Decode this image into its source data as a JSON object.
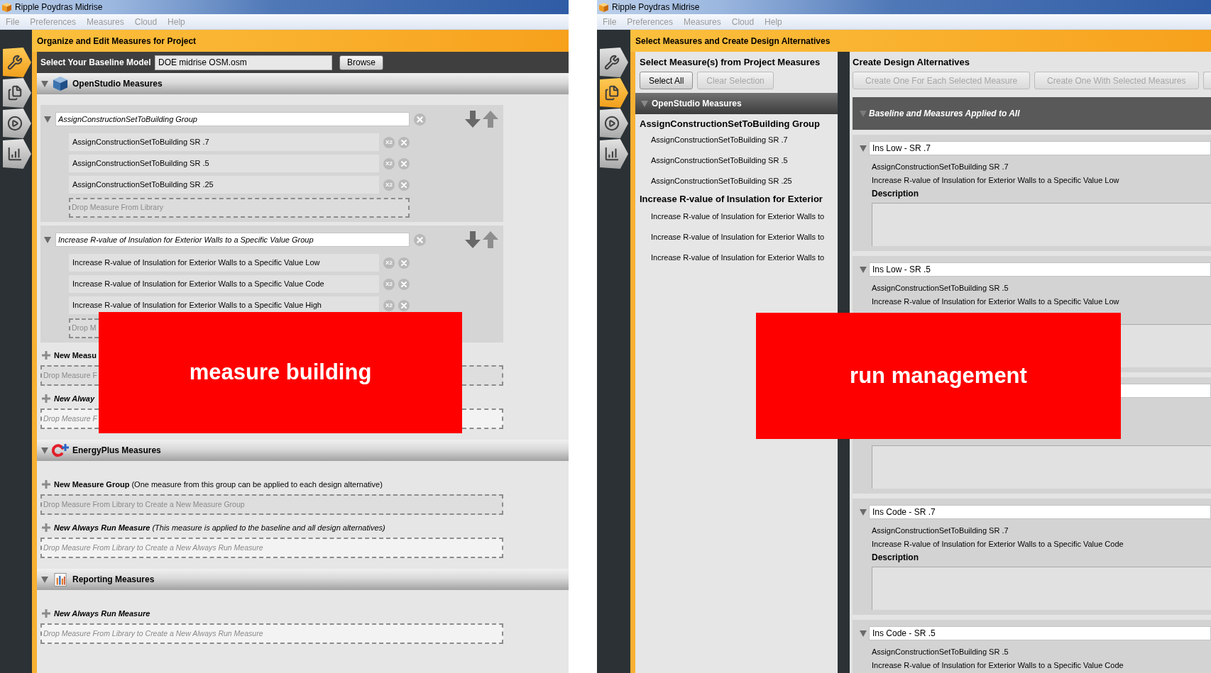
{
  "measure_window": {
    "title": "Ripple Poydras Midrise",
    "menu": [
      "File",
      "Preferences",
      "Measures",
      "Cloud",
      "Help"
    ],
    "side_tabs": [
      {
        "selected": true
      },
      {
        "selected": false
      },
      {
        "selected": false
      },
      {
        "selected": false
      }
    ],
    "header": "Organize and Edit Measures for Project",
    "baseline": {
      "label": "Select Your Baseline Model",
      "value": "DOE midrise OSM.osm",
      "button": "Browse"
    },
    "sections": [
      {
        "kind": "openstudio",
        "title": "OpenStudio Measures",
        "expanded": true,
        "groups": [
          {
            "name": "AssignConstructionSetToBuilding Group",
            "expanded": true,
            "measures": [
              {
                "name": "AssignConstructionSetToBuilding SR .7",
                "duplicate": "X2"
              },
              {
                "name": "AssignConstructionSetToBuilding SR .5",
                "duplicate": "X2"
              },
              {
                "name": "AssignConstructionSetToBuilding SR .25",
                "duplicate": "X2"
              }
            ],
            "drop_zone": {
              "kind": "whole",
              "text": "Drop Measure From Library"
            }
          },
          {
            "name": "Increase R-value of Insulation for Exterior Walls to a Specific Value Group",
            "expanded": true,
            "measures": [
              {
                "name": "Increase R-value of Insulation for Exterior Walls to a Specific Value Low",
                "duplicate": "X2"
              },
              {
                "name": "Increase R-value of Insulation for Exterior Walls to a Specific Value Code",
                "duplicate": "X2"
              },
              {
                "name": "Increase R-value of Insulation for Exterior Walls to a Specific Value High",
                "duplicate": "X2"
              }
            ],
            "drop_zone": {
              "kind": "clipped",
              "text": "Drop M"
            }
          }
        ],
        "new_group": {
          "title": "New Measu",
          "drop_zone": {
            "kind": "clipped",
            "text": "Drop Measure F"
          }
        },
        "always_run": {
          "title": "New Alway",
          "drop_zone": {
            "kind": "clipped",
            "text": "Drop Measure F"
          }
        }
      },
      {
        "kind": "energyplus",
        "title": "EnergyPlus Measures",
        "expanded": true,
        "new_group": {
          "title": "New Measure Group",
          "note": "(One measure from this group can be applied to each design alternative)",
          "drop_zone": {
            "kind": "whole",
            "text": "Drop Measure From Library to Create a New Measure Group"
          }
        },
        "always_run": {
          "title": "New Always Run Measure",
          "note": "(This measure is applied to the baseline and all design alternatives)",
          "drop_zone": {
            "kind": "whole",
            "text": "Drop Measure From Library to Create a New Always Run Measure"
          }
        }
      },
      {
        "kind": "reporting",
        "title": "Reporting Measures",
        "expanded": true,
        "always_run": {
          "title": "New Always Run Measure",
          "drop_zone": {
            "kind": "whole",
            "text": "Drop Measure From Library to Create a New Always Run Measure"
          }
        }
      }
    ],
    "annotation": "measure building"
  },
  "run_window": {
    "title": "Ripple Poydras Midrise",
    "menu": [
      "File",
      "Preferences",
      "Measures",
      "Cloud",
      "Help"
    ],
    "side_tabs": [
      {
        "selected": false
      },
      {
        "selected": true
      },
      {
        "selected": false
      },
      {
        "selected": false
      }
    ],
    "header": "Select Measures and Create Design Alternatives",
    "measure_panel": {
      "title": "Select Measure(s) from Project Measures",
      "buttons": [
        {
          "label": "Select All",
          "disabled": false
        },
        {
          "label": "Clear Selection",
          "disabled": true
        }
      ],
      "section": {
        "title": "OpenStudio Measures",
        "expanded": true
      },
      "groups": [
        {
          "name": "AssignConstructionSetToBuilding Group",
          "measures": [
            {
              "name": "AssignConstructionSetToBuilding SR .7",
              "selected": false
            },
            {
              "name": "AssignConstructionSetToBuilding SR .5",
              "selected": false
            },
            {
              "name": "AssignConstructionSetToBuilding SR .25",
              "selected": false
            }
          ]
        },
        {
          "name": "Increase R-value of Insulation for Exterior",
          "measures": [
            {
              "name": "Increase R-value of Insulation for Exterior Walls to",
              "selected": false
            },
            {
              "name": "Increase R-value of Insulation for Exterior Walls to",
              "selected": false
            },
            {
              "name": "Increase R-value of Insulation for Exterior Walls to",
              "selected": false
            }
          ]
        }
      ]
    },
    "alternatives_panel": {
      "title": "Create Design Alternatives",
      "buttons": [
        {
          "label": "Create One For Each Selected Measure",
          "disabled": true
        },
        {
          "label": "Create One With Selected Measures",
          "disabled": true
        }
      ],
      "baseline": {
        "title": "Baseline and Measures Applied to All"
      },
      "alternatives": [
        {
          "kind": "full",
          "name": "Ins Low - SR .7",
          "expanded": true,
          "measures": [
            "AssignConstructionSetToBuilding SR .7",
            "Increase R-value of Insulation for Exterior Walls to a Specific Value Low"
          ],
          "description_label": "Description"
        },
        {
          "kind": "partial",
          "name": "Ins Low - SR .5",
          "expanded": true,
          "measures": [
            "AssignConstructionSetToBuilding SR .5",
            "Increase R-value of Insulation for Exterior Walls to a Specific Value Low"
          ]
        },
        {
          "kind": "covered"
        },
        {
          "kind": "full",
          "name": "Ins Code - SR .7",
          "expanded": true,
          "measures": [
            "AssignConstructionSetToBuilding SR .7",
            "Increase R-value of Insulation for Exterior Walls to a Specific Value Code"
          ],
          "description_label": "Description"
        },
        {
          "kind": "full",
          "name": "Ins Code - SR .5",
          "expanded": true,
          "measures": [
            "AssignConstructionSetToBuilding SR .5",
            "Increase R-value of Insulation for Exterior Walls to a Specific Value Code"
          ]
        }
      ]
    },
    "annotation": "run management"
  }
}
